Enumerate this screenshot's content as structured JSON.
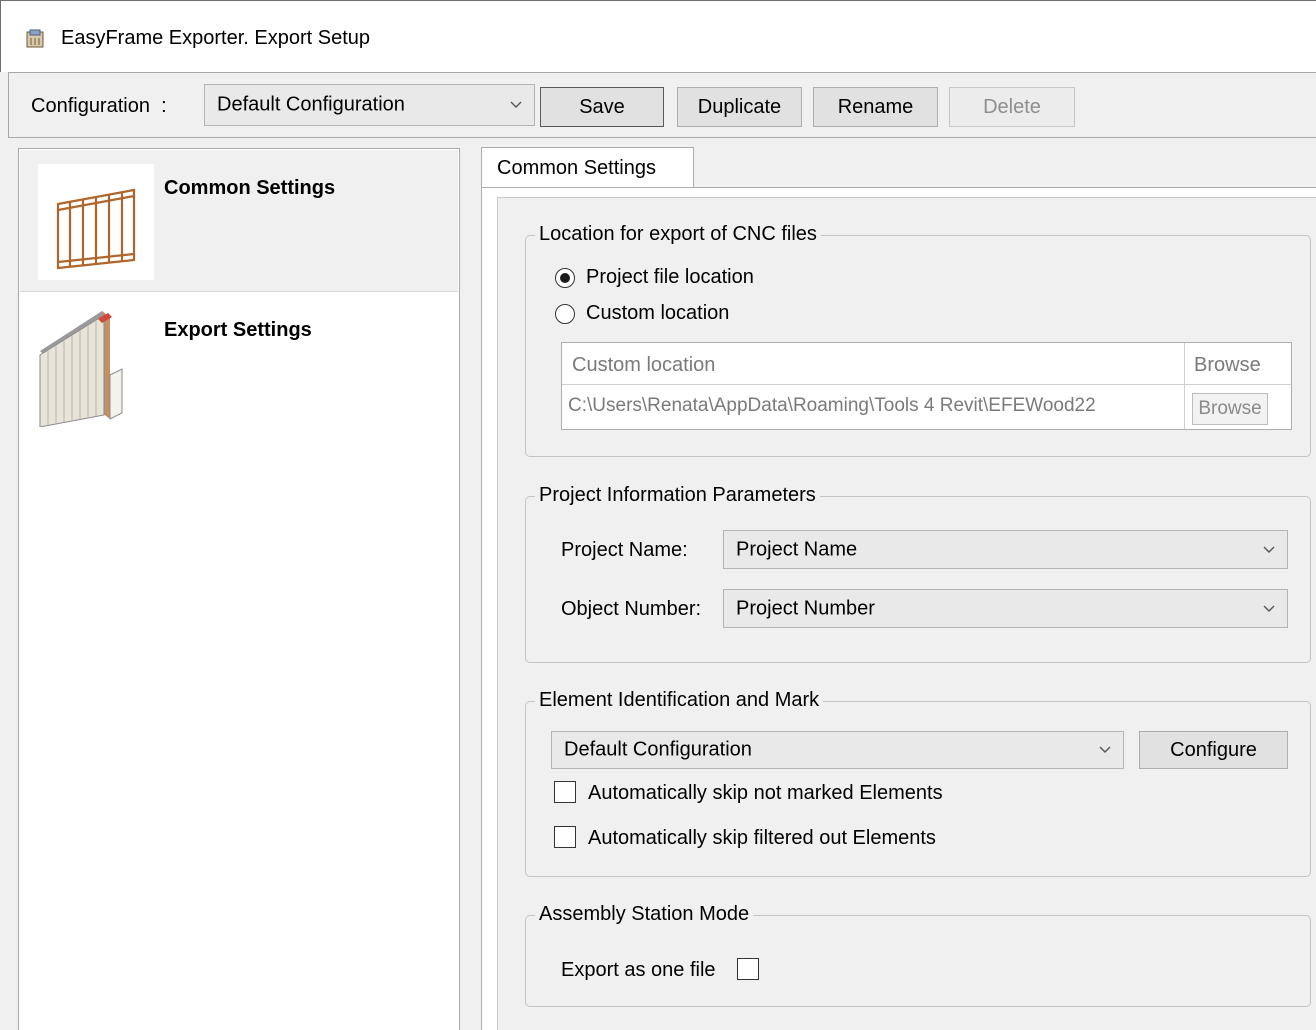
{
  "window": {
    "title": "EasyFrame Exporter. Export Setup",
    "icon": "app-icon"
  },
  "config_bar": {
    "label": "Configuration",
    "separator": ":",
    "selected": "Default Configuration",
    "buttons": {
      "save": "Save",
      "duplicate": "Duplicate",
      "rename": "Rename",
      "delete": "Delete"
    }
  },
  "nav": {
    "items": [
      {
        "label": "Common Settings",
        "icon": "wall-frame-icon",
        "selected": true
      },
      {
        "label": "Export Settings",
        "icon": "wall-panel-icon",
        "selected": false
      }
    ]
  },
  "tab": {
    "label": "Common Settings"
  },
  "location_group": {
    "title": "Location for export of CNC files",
    "options": [
      {
        "label": "Project file location",
        "checked": true
      },
      {
        "label": "Custom location",
        "checked": false
      }
    ],
    "grid": {
      "headers": [
        "Custom location",
        "Browse"
      ],
      "path": "C:\\Users\\Renata\\AppData\\Roaming\\Tools 4 Revit\\EFEWood22",
      "browse_button": "Browse"
    }
  },
  "project_info_group": {
    "title": "Project Information Parameters",
    "project_name_label": "Project Name:",
    "project_name_value": "Project Name",
    "object_number_label": "Object Number:",
    "object_number_value": "Project Number"
  },
  "element_group": {
    "title": "Element Identification and Mark",
    "selected": "Default Configuration",
    "configure_button": "Configure",
    "skip_not_marked": {
      "label": "Automatically skip not marked Elements",
      "checked": false
    },
    "skip_filtered": {
      "label": "Automatically skip filtered out Elements",
      "checked": false
    }
  },
  "assembly_group": {
    "title": "Assembly Station Mode",
    "export_one_file": {
      "label": "Export as one file",
      "checked": false
    }
  }
}
